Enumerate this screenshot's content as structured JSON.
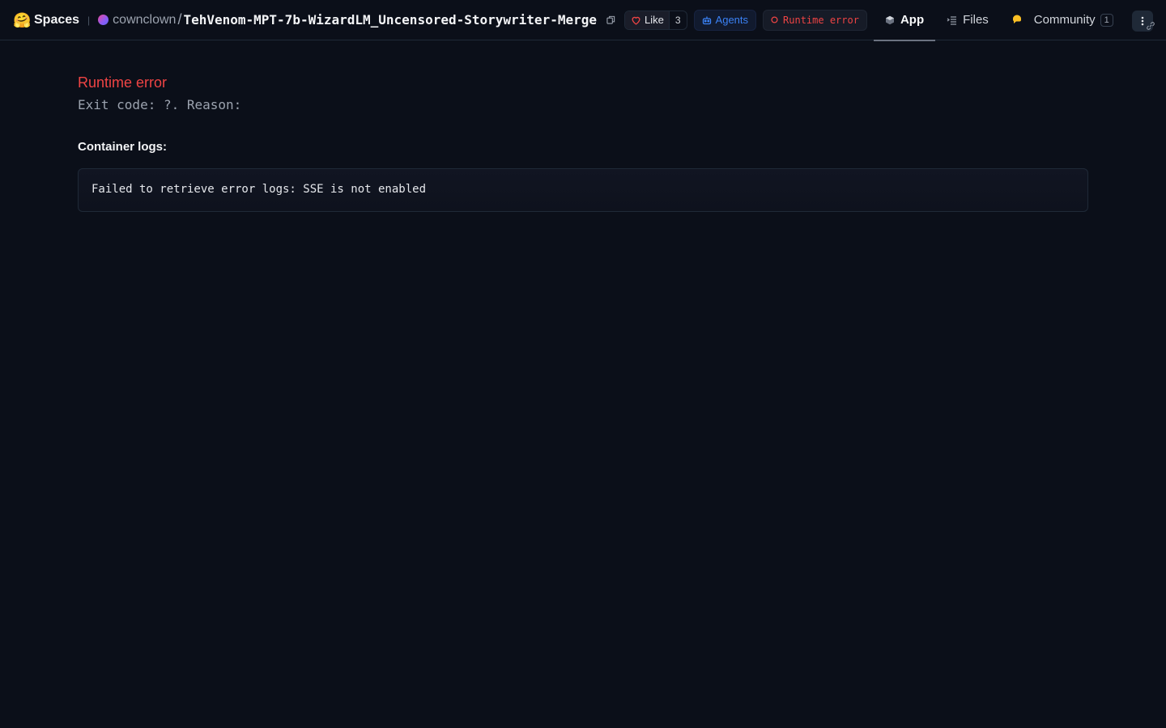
{
  "header": {
    "brand_emoji": "🤗",
    "brand_label": "Spaces",
    "owner": "cownclown",
    "repo_name": "TehVenom-MPT-7b-WizardLM_Uncensored-Storywriter-Merge",
    "like_label": "Like",
    "like_count": "3",
    "agents_label": "Agents",
    "status_label": "Runtime error",
    "tabs": [
      {
        "label": "App",
        "active": true
      },
      {
        "label": "Files",
        "active": false
      },
      {
        "label": "Community",
        "active": false,
        "badge": "1"
      }
    ]
  },
  "main": {
    "error_title": "Runtime error",
    "error_reason": "Exit code: ?. Reason:",
    "logs_heading": "Container logs:",
    "logs_text": "Failed to retrieve error logs: SSE is not enabled"
  },
  "colors": {
    "background": "#0b0f19",
    "error": "#ef4444",
    "agents": "#3b82f6"
  },
  "icons": [
    "hugging-face-icon",
    "copy-icon",
    "heart-icon",
    "robot-icon",
    "error-circle-icon",
    "cube-icon",
    "files-icon",
    "community-icon",
    "kebab-menu-icon",
    "link-icon"
  ]
}
